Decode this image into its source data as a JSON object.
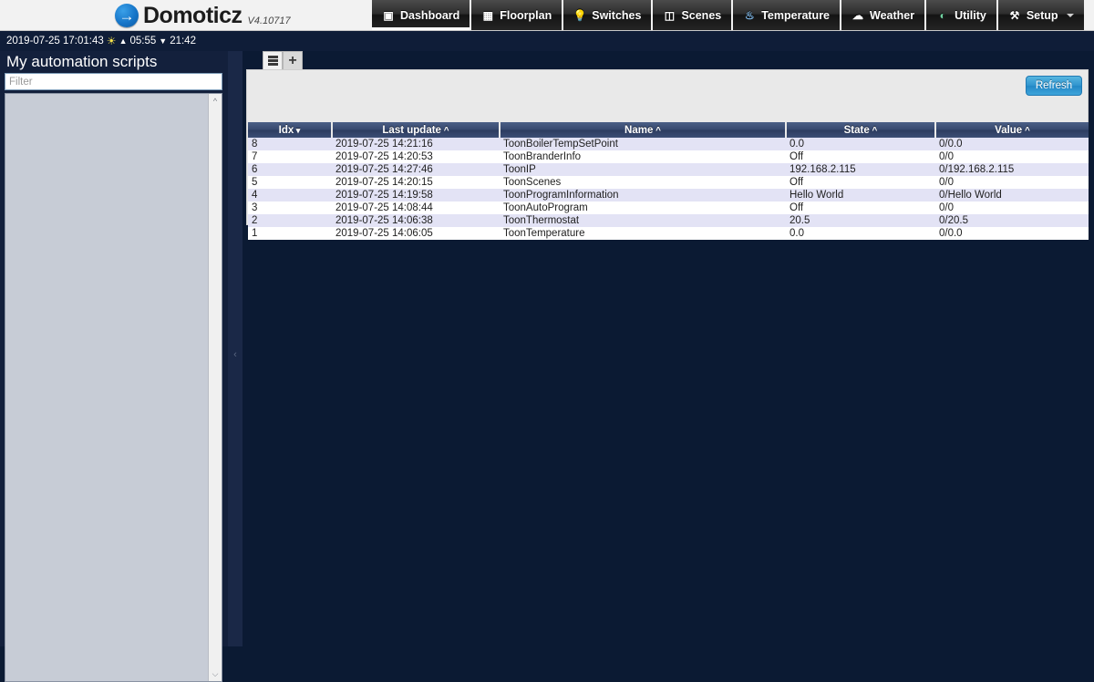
{
  "brand": {
    "name": "Domoticz",
    "version": "V4.10717",
    "logo_glyph": "→"
  },
  "nav": {
    "items": [
      {
        "label": "Dashboard",
        "icon": "Ὓ5",
        "icon_glyph": "▣",
        "name": "dashboard",
        "active": true
      },
      {
        "label": "Floorplan",
        "icon_glyph": "☷",
        "name": "floorplan",
        "active": false
      },
      {
        "label": "Switches",
        "icon_glyph": "Ὂ1",
        "name": "switches",
        "active": false
      },
      {
        "label": "Scenes",
        "icon_glyph": "ἺC",
        "name": "scenes",
        "active": false
      },
      {
        "label": "Temperature",
        "icon_glyph": "ἲ1",
        "name": "temperature",
        "active": false
      },
      {
        "label": "Weather",
        "icon_glyph": "☁",
        "name": "weather",
        "active": false
      },
      {
        "label": "Utility",
        "icon_glyph": "◔",
        "name": "utility",
        "active": false
      },
      {
        "label": "Setup",
        "icon_glyph": "⚒",
        "name": "setup",
        "active": false,
        "has_dropdown": true
      }
    ]
  },
  "status": {
    "datetime": "2019-07-25 17:01:43",
    "sun_icon": "☀",
    "sunrise_icon": "▲",
    "sunrise": "05:55",
    "sunset_icon": "▼",
    "sunset": "21:42"
  },
  "sidebar": {
    "title": "My automation scripts",
    "filter_placeholder": "Filter",
    "filter_value": "",
    "scroll_up_icon": "^",
    "scroll_down_icon": "⌵",
    "items": []
  },
  "divider": {
    "collapse_icon": "‹"
  },
  "tabs": [
    {
      "name": "list-view",
      "icon": "list-icon",
      "active": true
    },
    {
      "name": "add-item",
      "icon": "plus-icon",
      "label": "+",
      "active": false
    }
  ],
  "toolbar": {
    "refresh_label": "Refresh"
  },
  "table": {
    "columns": [
      {
        "label": "Idx",
        "sort": "desc",
        "key": "idx"
      },
      {
        "label": "Last update",
        "sort": "asc",
        "key": "last_update"
      },
      {
        "label": "Name",
        "sort": "asc",
        "key": "name"
      },
      {
        "label": "State",
        "sort": "asc",
        "key": "state"
      },
      {
        "label": "Value",
        "sort": "asc",
        "key": "value"
      }
    ],
    "rows": [
      {
        "idx": "8",
        "last_update": "2019-07-25 14:21:16",
        "name": "ToonBoilerTempSetPoint",
        "state": "0.0",
        "value": "0/0.0"
      },
      {
        "idx": "7",
        "last_update": "2019-07-25 14:20:53",
        "name": "ToonBranderInfo",
        "state": "Off",
        "value": "0/0"
      },
      {
        "idx": "6",
        "last_update": "2019-07-25 14:27:46",
        "name": "ToonIP",
        "state": "192.168.2.115",
        "value": "0/192.168.2.115"
      },
      {
        "idx": "5",
        "last_update": "2019-07-25 14:20:15",
        "name": "ToonScenes",
        "state": "Off",
        "value": "0/0"
      },
      {
        "idx": "4",
        "last_update": "2019-07-25 14:19:58",
        "name": "ToonProgramInformation",
        "state": "Hello World",
        "value": "0/Hello World"
      },
      {
        "idx": "3",
        "last_update": "2019-07-25 14:08:44",
        "name": "ToonAutoProgram",
        "state": "Off",
        "value": "0/0"
      },
      {
        "idx": "2",
        "last_update": "2019-07-25 14:06:38",
        "name": "ToonThermostat",
        "state": "20.5",
        "value": "0/20.5"
      },
      {
        "idx": "1",
        "last_update": "2019-07-25 14:06:05",
        "name": "ToonTemperature",
        "state": "0.0",
        "value": "0/0.0"
      }
    ]
  },
  "colors": {
    "page_bg": "#0b1a33",
    "panel_bg": "#e9e9e9",
    "header_blue": "#36486e",
    "row_odd": "#e3e3f5",
    "accent": "#2f93ce",
    "brand_blue": "#1675c8"
  }
}
